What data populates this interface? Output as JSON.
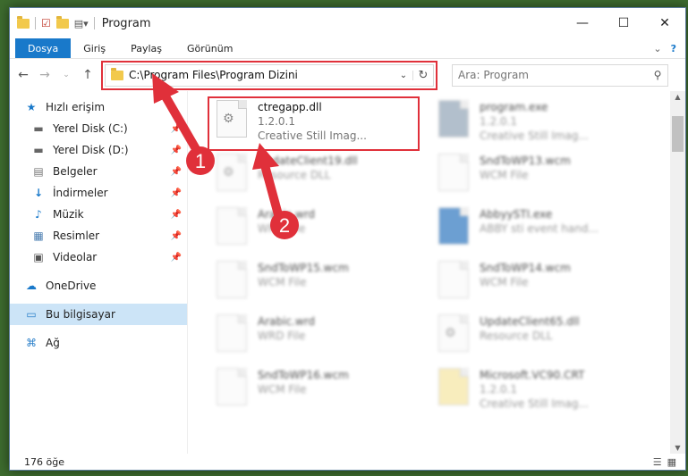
{
  "window": {
    "title": "Program",
    "controls": {
      "minimize": "—",
      "maximize": "☐",
      "close": "✕"
    }
  },
  "ribbon": {
    "tabs": [
      "Dosya",
      "Giriş",
      "Paylaş",
      "Görünüm"
    ],
    "collapse": "⌄",
    "help": "?"
  },
  "address": {
    "path": "C:\\Program Files\\Program Dizini",
    "search_placeholder": "Ara: Program"
  },
  "sidebar": {
    "items": [
      {
        "label": "Hızlı erişim",
        "icon": "star-icon",
        "glyph": "★"
      },
      {
        "label": "Yerel Disk (C:)",
        "icon": "drive-icon",
        "glyph": "▬"
      },
      {
        "label": "Yerel Disk (D:)",
        "icon": "drive-icon",
        "glyph": "▬"
      },
      {
        "label": "Belgeler",
        "icon": "documents-icon",
        "glyph": "▤"
      },
      {
        "label": "İndirmeler",
        "icon": "download-icon",
        "glyph": "↓"
      },
      {
        "label": "Müzik",
        "icon": "music-icon",
        "glyph": "♪"
      },
      {
        "label": "Resimler",
        "icon": "pictures-icon",
        "glyph": "▦"
      },
      {
        "label": "Videolar",
        "icon": "video-icon",
        "glyph": "▣"
      },
      {
        "label": "OneDrive",
        "icon": "cloud-icon",
        "glyph": "☁"
      },
      {
        "label": "Bu bilgisayar",
        "icon": "computer-icon",
        "glyph": "▭"
      },
      {
        "label": "Ağ",
        "icon": "network-icon",
        "glyph": "⌘"
      }
    ]
  },
  "files": [
    {
      "name": "ctregapp.dll",
      "line2": "1.2.0.1",
      "line3": "Creative Still Imag..."
    },
    {
      "name": "program.exe",
      "line2": "1.2.0.1",
      "line3": "Creative Still Imag..."
    },
    {
      "name": "UpdateClient19.dll",
      "line2": "Resource DLL",
      "line3": ""
    },
    {
      "name": "SndToWP13.wcm",
      "line2": "WCM File",
      "line3": ""
    },
    {
      "name": "Arabic.wrd",
      "line2": "WRD File",
      "line3": ""
    },
    {
      "name": "AbbyySTI.exe",
      "line2": "ABBY sti event hand...",
      "line3": ""
    },
    {
      "name": "SndToWP15.wcm",
      "line2": "WCM File",
      "line3": ""
    },
    {
      "name": "SndToWP14.wcm",
      "line2": "WCM File",
      "line3": ""
    },
    {
      "name": "Arabic.wrd",
      "line2": "WRD File",
      "line3": ""
    },
    {
      "name": "UpdateClient65.dll",
      "line2": "Resource DLL",
      "line3": ""
    },
    {
      "name": "SndToWP16.wcm",
      "line2": "WCM File",
      "line3": ""
    },
    {
      "name": "Microsoft.VC90.CRT",
      "line2": "1.2.0.1",
      "line3": "Creative Still Imag..."
    }
  ],
  "status": {
    "count": "176 öğe"
  },
  "annotations": {
    "step1": "1",
    "step2": "2"
  },
  "colors": {
    "accent": "#1979ca",
    "highlight": "#e0303a",
    "selected": "#cce4f7"
  }
}
